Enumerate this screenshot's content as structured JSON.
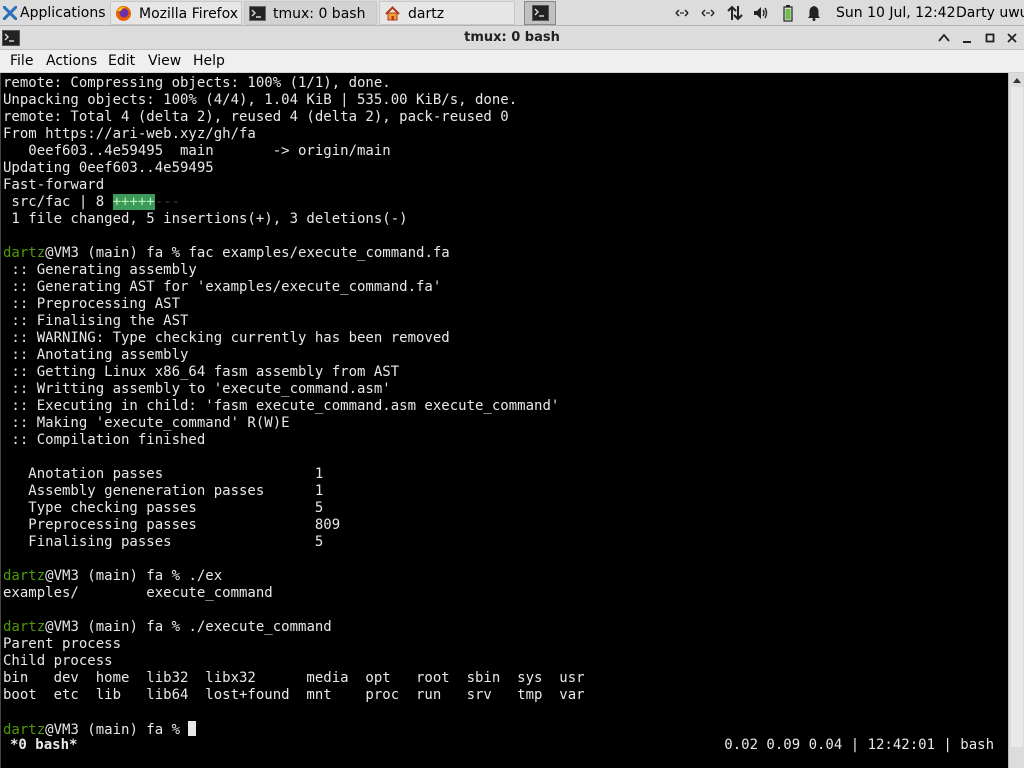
{
  "panel": {
    "applications_label": "Applications",
    "tasks": [
      {
        "label": "Mozilla Firefox",
        "icon": "firefox-icon"
      },
      {
        "label": "tmux: 0 bash",
        "icon": "terminal-icon"
      },
      {
        "label": "dartz",
        "icon": "home-folder-icon"
      }
    ],
    "clock": "Sun 10 Jul, 12:42",
    "user": "Darty uwu"
  },
  "window": {
    "title": "tmux: 0 bash"
  },
  "menubar": {
    "items": [
      "File",
      "Actions",
      "Edit",
      "View",
      "Help"
    ]
  },
  "terminal": {
    "lines": [
      "remote: Compressing objects: 100% (1/1), done.",
      "Unpacking objects: 100% (4/4), 1.04 KiB | 535.00 KiB/s, done.",
      "remote: Total 4 (delta 2), reused 4 (delta 2), pack-reused 0",
      "From https://ari-web.xyz/gh/fa",
      "   0eef603..4e59495  main       -> origin/main",
      "Updating 0eef603..4e59495",
      "Fast-forward",
      " src/fac | 8 ",
      " 1 file changed, 5 insertions(+), 3 deletions(-)",
      "",
      " (main) fa % fac examples/execute_command.fa",
      " :: Generating assembly",
      " :: Generating AST for 'examples/execute_command.fa'",
      " :: Preprocessing AST",
      " :: Finalising the AST",
      " :: WARNING: Type checking currently has been removed",
      " :: Anotating assembly",
      " :: Getting Linux x86_64 fasm assembly from AST",
      " :: Writting assembly to 'execute_command.asm'",
      " :: Executing in child: 'fasm execute_command.asm execute_command'",
      " :: Making 'execute_command' R(W)E",
      " :: Compilation finished",
      "",
      "   Anotation passes                  1",
      "   Assembly geneneration passes      1",
      "   Type checking passes              5",
      "   Preprocessing passes              809",
      "   Finalising passes                 5",
      "",
      " (main) fa % ./ex",
      "examples/        execute_command",
      "",
      " (main) fa % ./execute_command",
      "Parent process",
      "Child process",
      "bin   dev  home  lib32  libx32      media  opt   root  sbin  sys  usr",
      "boot  etc  lib   lib64  lost+found  mnt    proc  run   srv   tmp  var",
      "",
      " (main) fa % "
    ],
    "diffstat_plus": "+++++",
    "diffstat_minus": "---",
    "prompt_user": "dartz",
    "prompt_host": "@VM3",
    "prompt_line_indices": [
      10,
      29,
      32,
      38
    ],
    "diffstat_line_index": 7
  },
  "tmux_status": {
    "left": "*0 bash*",
    "right": "0.02 0.09 0.04 | 12:42:01 | bash"
  }
}
